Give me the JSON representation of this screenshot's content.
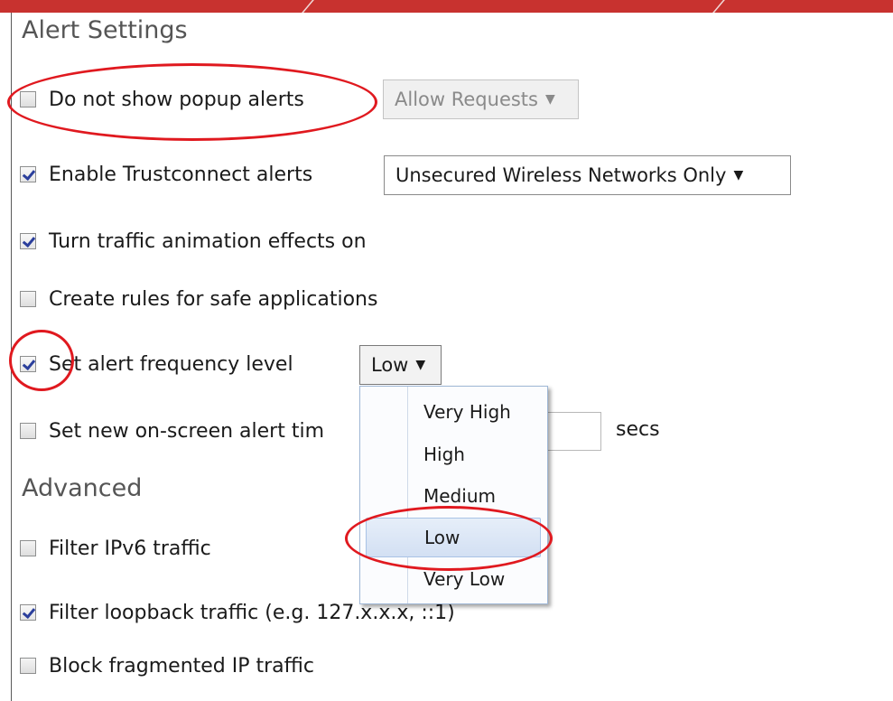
{
  "sections": {
    "alert_settings_title": "Alert Settings",
    "advanced_title": "Advanced"
  },
  "options": {
    "popup_alerts": {
      "label": "Do not show popup alerts",
      "checked": false
    },
    "trustconnect": {
      "label": "Enable Trustconnect alerts",
      "checked": true
    },
    "animation": {
      "label": "Turn traffic animation effects on",
      "checked": true
    },
    "safe_apps": {
      "label": "Create rules for safe applications",
      "checked": false
    },
    "frequency": {
      "label": "Set alert frequency level",
      "checked": true
    },
    "alert_time": {
      "label": "Set new on-screen alert tim",
      "checked": false
    },
    "ipv6": {
      "label": "Filter IPv6 traffic",
      "checked": false
    },
    "loopback": {
      "label": "Filter loopback traffic (e.g. 127.x.x.x, ::1)",
      "checked": true
    },
    "fragmented": {
      "label": "Block fragmented IP traffic",
      "checked": false
    }
  },
  "dropdowns": {
    "popup_action": {
      "value": "Allow Requests",
      "disabled": true
    },
    "trustconnect_scope": {
      "value": "Unsecured Wireless Networks Only"
    },
    "frequency_level": {
      "value": "Low"
    }
  },
  "alert_time_unit": "secs",
  "frequency_menu": {
    "options": [
      "Very High",
      "High",
      "Medium",
      "Low",
      "Very Low"
    ],
    "selected": "Low"
  },
  "colors": {
    "accent_red": "#e0191f",
    "checkmark": "#2b3f9c",
    "menu_selection": "#d3e0f3"
  }
}
